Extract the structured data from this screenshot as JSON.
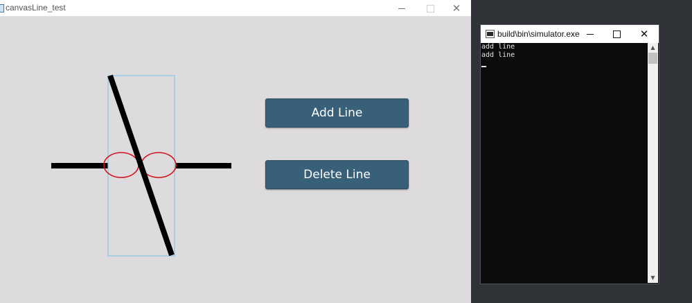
{
  "app": {
    "title": "canvasLine_test",
    "buttons": {
      "add_label": "Add Line",
      "delete_label": "Delete Line"
    },
    "colors": {
      "background": "#dedbdf",
      "line": "#000000",
      "selection_box": "#86c9e4",
      "handle_circle": "#d4121a",
      "button": "#386078"
    }
  },
  "console": {
    "title": "build\\bin\\simulator.exe",
    "lines": [
      "add line",
      "add line"
    ]
  }
}
